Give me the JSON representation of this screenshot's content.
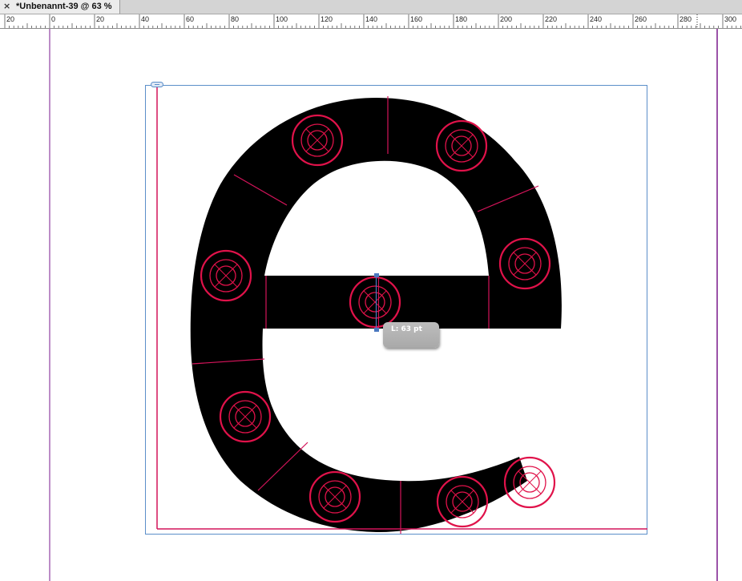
{
  "tab": {
    "title": "*Unbenannt-39 @ 63 %",
    "close_glyph": "×"
  },
  "ruler": {
    "labels": [
      "20",
      "0",
      "20",
      "40",
      "60",
      "80",
      "100",
      "120",
      "140",
      "160",
      "180",
      "200",
      "220",
      "240",
      "260",
      "280",
      "300"
    ]
  },
  "tooltip": {
    "text": "L: 63 pt"
  },
  "colors": {
    "accent": "#e0124a",
    "frame": "#5b8fc9",
    "margin": "#7a1a8c",
    "glyph": "#000000"
  },
  "icons": [
    "close-icon",
    "link-icon",
    "target-marker-icon"
  ]
}
